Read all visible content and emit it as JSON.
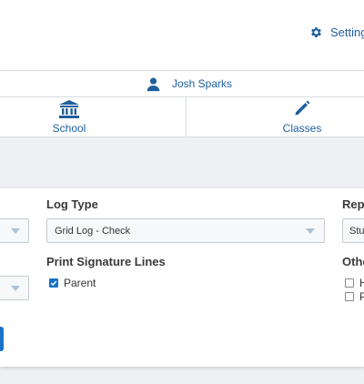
{
  "header": {
    "settings_label": "Settings",
    "settings_icon": "gear-icon",
    "user_name": "Josh Sparks",
    "user_icon": "user-icon"
  },
  "nav": {
    "tiles": [
      {
        "label": "School",
        "icon": "school-icon"
      },
      {
        "label": "Classes",
        "icon": "pencil-icon"
      }
    ]
  },
  "options": {
    "log_type": {
      "label": "Log Type",
      "value": "Grid Log - Check"
    },
    "report_section": {
      "label": "Rep",
      "value": "Stu"
    },
    "signature": {
      "label": "Print Signature Lines",
      "parent_label": "Parent",
      "parent_checked": true
    },
    "other": {
      "label": "Othe",
      "item1_label": "H",
      "item2_label": "P"
    }
  },
  "colors": {
    "link_blue": "#1f5f9e",
    "accent_blue": "#1a73c8",
    "band_grey": "#eef0f3"
  }
}
